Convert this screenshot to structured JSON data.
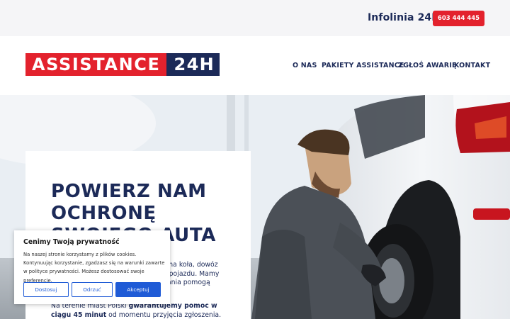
{
  "topbar": {
    "hotline_label": "Infolinia 24H",
    "phone_number": "603 444 445"
  },
  "header": {
    "logo_part1": "ASSISTANCE",
    "logo_part2": "24H",
    "nav": [
      "O NAS",
      "PAKIETY ASSISTANCE",
      "ZGŁOŚ AWARIĘ",
      "KONTAKT"
    ]
  },
  "hero": {
    "headline_lines": [
      "POWIERZ NAM",
      "OCHRONĘ",
      "SWOJEGO AUTA"
    ],
    "paragraph_visible_lines": [
      "iana koła, dowóz",
      "a pojazdu. Mamy",
      "hania pomogą"
    ],
    "paragraph2_prefix": "Na terenie miast Polski ",
    "paragraph2_bold": "gwarantujemy pomoc w ciągu 45 minut",
    "paragraph2_suffix": " od momentu przyjęcia zgłoszenia."
  },
  "cookie": {
    "title": "Cenimy Twoją prywatność",
    "text": "Na naszej stronie korzystamy z plików cookies. Kontynuując korzystanie, zgadzasz się na warunki zawarte w polityce prywatności. Możesz dostosować swoje preferencje.",
    "btn_customize": "Dostosuj",
    "btn_reject": "Odrzuć",
    "btn_accept": "Akceptuj"
  },
  "colors": {
    "brand_red": "#e3222d",
    "brand_navy": "#1c2a58",
    "cookie_blue": "#1f5bd6"
  }
}
